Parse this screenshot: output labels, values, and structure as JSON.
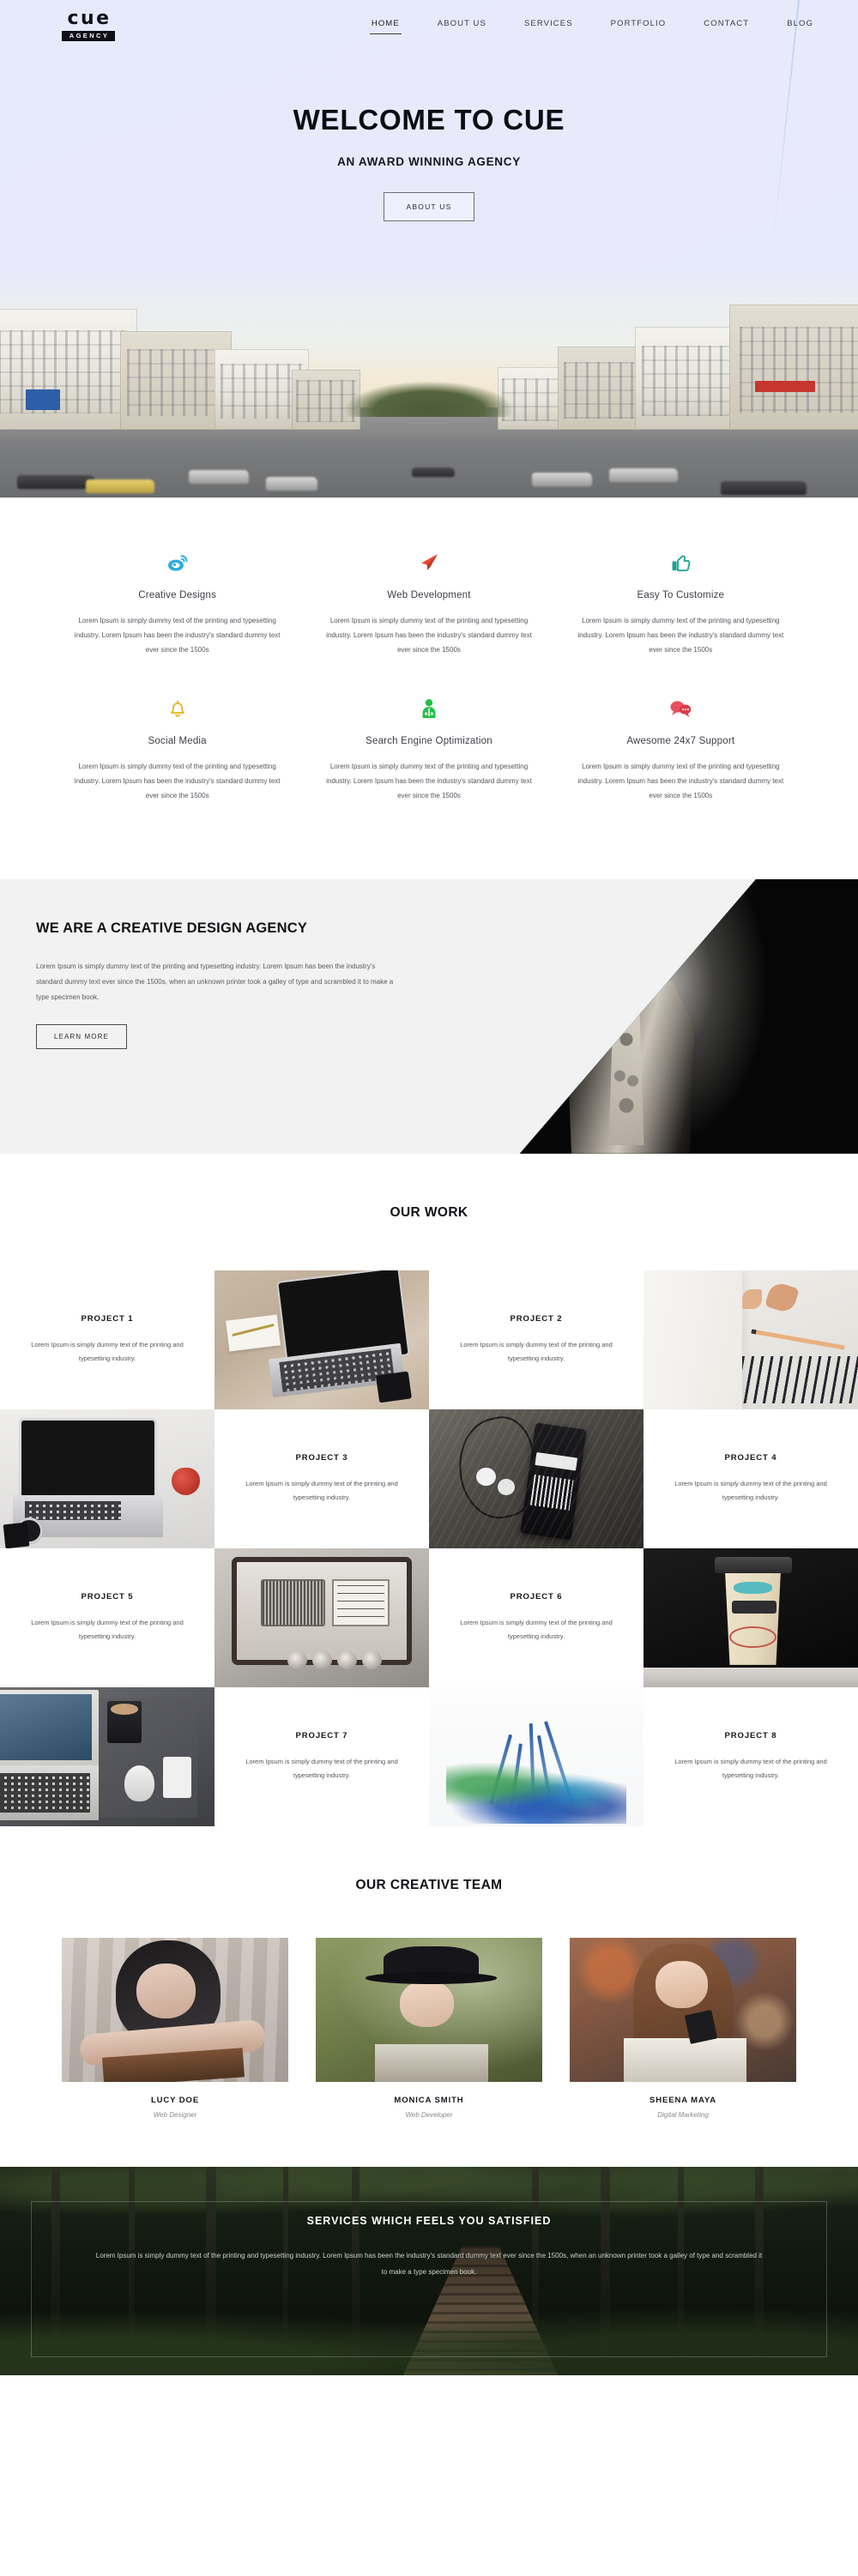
{
  "brand": {
    "name": "cue",
    "tagline": "AGENCY"
  },
  "nav": {
    "items": [
      {
        "label": "HOME",
        "active": true
      },
      {
        "label": "ABOUT US",
        "active": false
      },
      {
        "label": "SERVICES",
        "active": false
      },
      {
        "label": "PORTFOLIO",
        "active": false
      },
      {
        "label": "CONTACT",
        "active": false
      },
      {
        "label": "BLOG",
        "active": false
      }
    ]
  },
  "hero": {
    "title": "WELCOME TO CUE",
    "subtitle": "AN AWARD WINNING AGENCY",
    "button": "ABOUT US"
  },
  "services": [
    {
      "icon": "cloud-weibo-icon",
      "color": "#2eaade",
      "title": "Creative Designs",
      "text": "Lorem Ipsum is simply dummy text of the printing and typesetting industry. Lorem Ipsum has been the industry's standard dummy text ever since the 1500s"
    },
    {
      "icon": "paper-plane-icon",
      "color": "#e8452c",
      "title": "Web Development",
      "text": "Lorem Ipsum is simply dummy text of the printing and typesetting industry. Lorem Ipsum has been the industry's standard dummy text ever since the 1500s"
    },
    {
      "icon": "thumbs-up-icon",
      "color": "#19a38e",
      "title": "Easy To Customize",
      "text": "Lorem Ipsum is simply dummy text of the printing and typesetting industry. Lorem Ipsum has been the industry's standard dummy text ever since the 1500s"
    },
    {
      "icon": "bell-icon",
      "color": "#e3b417",
      "title": "Social Media",
      "text": "Lorem Ipsum is simply dummy text of the printing and typesetting industry. Lorem Ipsum has been the industry's standard dummy text ever since the 1500s"
    },
    {
      "icon": "user-person-icon",
      "color": "#22c247",
      "title": "Search Engine Optimization",
      "text": "Lorem Ipsum is simply dummy text of the printing and typesetting industry. Lorem Ipsum has been the industry's standard dummy text ever since the 1500s"
    },
    {
      "icon": "chat-bubbles-icon",
      "color": "#e8505b",
      "title": "Awesome 24x7 Support",
      "text": "Lorem Ipsum is simply dummy text of the printing and typesetting industry. Lorem Ipsum has been the industry's standard dummy text ever since the 1500s"
    }
  ],
  "about": {
    "title": "WE ARE A CREATIVE DESIGN AGENCY",
    "text": "Lorem Ipsum is simply dummy text of the printing and typesetting industry. Lorem Ipsum has been the industry's standard dummy text ever since the 1500s, when an unknown printer took a galley of type and scrambled it to make a type specimen book.",
    "button": "LEARN MORE",
    "image": "man-portrait-bw"
  },
  "work": {
    "title": "OUR WORK",
    "projects": [
      {
        "title": "PROJECT 1",
        "text": "Lorem Ipsum is simply dummy text of the printing and typesetting industry.",
        "image": "laptop-on-wood-desk"
      },
      {
        "title": "PROJECT 2",
        "text": "Lorem Ipsum is simply dummy text of the printing and typesetting industry.",
        "image": "pencil-shavings-notebook"
      },
      {
        "title": "PROJECT 3",
        "text": "Lorem Ipsum is simply dummy text of the printing and typesetting industry.",
        "image": "laptop-apple-phone"
      },
      {
        "title": "PROJECT 4",
        "text": "Lorem Ipsum is simply dummy text of the printing and typesetting industry.",
        "image": "mp3-player-earphones-bw"
      },
      {
        "title": "PROJECT 5",
        "text": "Lorem Ipsum is simply dummy text of the printing and typesetting industry.",
        "image": "vintage-radio"
      },
      {
        "title": "PROJECT 6",
        "text": "Lorem Ipsum is simply dummy text of the printing and typesetting industry.",
        "image": "coffee-cup-bicycle-art"
      },
      {
        "title": "PROJECT 7",
        "text": "Lorem Ipsum is simply dummy text of the printing and typesetting industry.",
        "image": "desk-laptop-mouse-phone"
      },
      {
        "title": "PROJECT 8",
        "text": "Lorem Ipsum is simply dummy text of the printing and typesetting industry.",
        "image": "colored-pencils-splash"
      }
    ]
  },
  "team": {
    "title": "OUR CREATIVE TEAM",
    "members": [
      {
        "name": "LUCY DOE",
        "role": "Web Designer",
        "image": "woman-leaning-chair"
      },
      {
        "name": "MONICA SMITH",
        "role": "Web Developer",
        "image": "woman-black-hat-outdoors"
      },
      {
        "name": "SHEENA MAYA",
        "role": "Digital Marketing",
        "image": "woman-with-phone-street"
      }
    ]
  },
  "cta": {
    "title": "SERVICES WHICH FEELS YOU SATISFIED",
    "text": "Lorem Ipsum is simply dummy text of the printing and typesetting industry. Lorem Ipsum has been the industry's standard dummy text ever since the 1500s, when an unknown printer took a galley of type and scrambled it to make a type specimen book.",
    "background": "dark-forest-path"
  }
}
